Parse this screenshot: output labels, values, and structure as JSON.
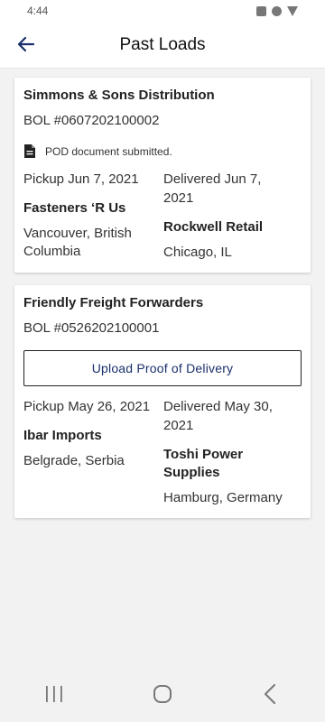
{
  "status_bar": {
    "time": "4:44"
  },
  "header": {
    "title": "Past Loads"
  },
  "loads": [
    {
      "customer": "Simmons & Sons Distribution",
      "bol": "BOL #0607202100002",
      "pod_status": "POD document submitted.",
      "pickup_date": "Pickup Jun 7, 2021",
      "delivered_date": "Delivered Jun 7, 2021",
      "shipper": "Fasteners ‘R Us",
      "consignee": "Rockwell Retail",
      "origin": "Vancouver, British Columbia",
      "destination": "Chicago, IL"
    },
    {
      "customer": "Friendly Freight Forwarders",
      "bol": "BOL #0526202100001",
      "upload_label": "Upload Proof of Delivery",
      "pickup_date": "Pickup May 26, 2021",
      "delivered_date": "Delivered May 30, 2021",
      "shipper": "Ibar Imports",
      "consignee": "Toshi Power Supplies",
      "origin": "Belgrade, Serbia",
      "destination": "Hamburg, Germany"
    }
  ],
  "colors": {
    "accent": "#1a2f6b",
    "background": "#f2f2f2",
    "card": "#ffffff"
  },
  "icons": {
    "back": "arrow-left-icon",
    "pod": "document-icon"
  }
}
